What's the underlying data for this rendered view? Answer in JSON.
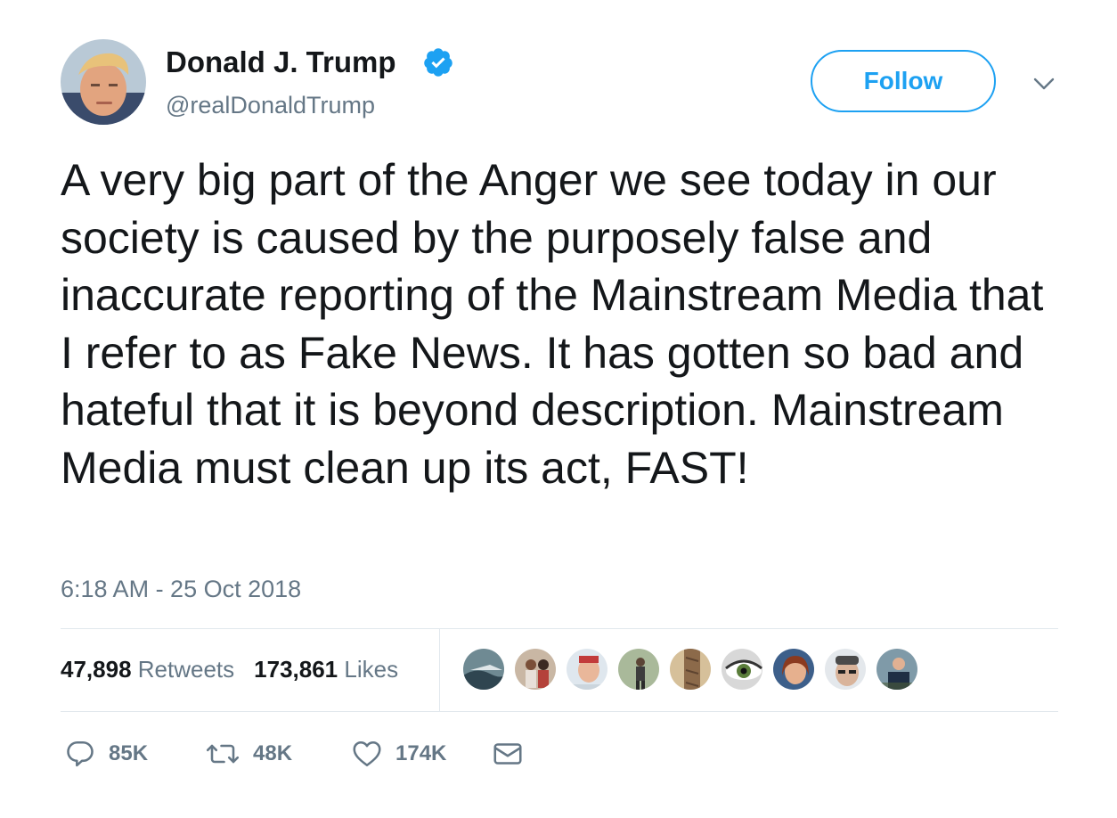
{
  "author": {
    "name": "Donald J. Trump",
    "handle": "@realDonaldTrump",
    "verified": true
  },
  "follow_button": {
    "label": "Follow"
  },
  "tweet": {
    "text": "A very big part of the Anger we see today in our society is caused by the purposely false and inaccurate reporting of the Mainstream Media that I refer to as Fake News. It has gotten so bad and hateful that it is beyond description. Mainstream Media must clean up its act, FAST!",
    "timestamp": "6:18 AM - 25 Oct 2018"
  },
  "stats": {
    "retweets_count": "47,898",
    "retweets_label": "Retweets",
    "likes_count": "173,861",
    "likes_label": "Likes"
  },
  "actions": {
    "replies": "85K",
    "retweets": "48K",
    "likes": "174K"
  },
  "icons": {
    "verified": "verified-badge-icon",
    "more": "chevron-down-icon",
    "reply": "reply-icon",
    "retweet": "retweet-icon",
    "like": "heart-icon",
    "dm": "envelope-icon"
  },
  "colors": {
    "accent": "#1da1f2",
    "text": "#14171a",
    "secondary": "#657786",
    "divider": "#e1e8ed"
  }
}
